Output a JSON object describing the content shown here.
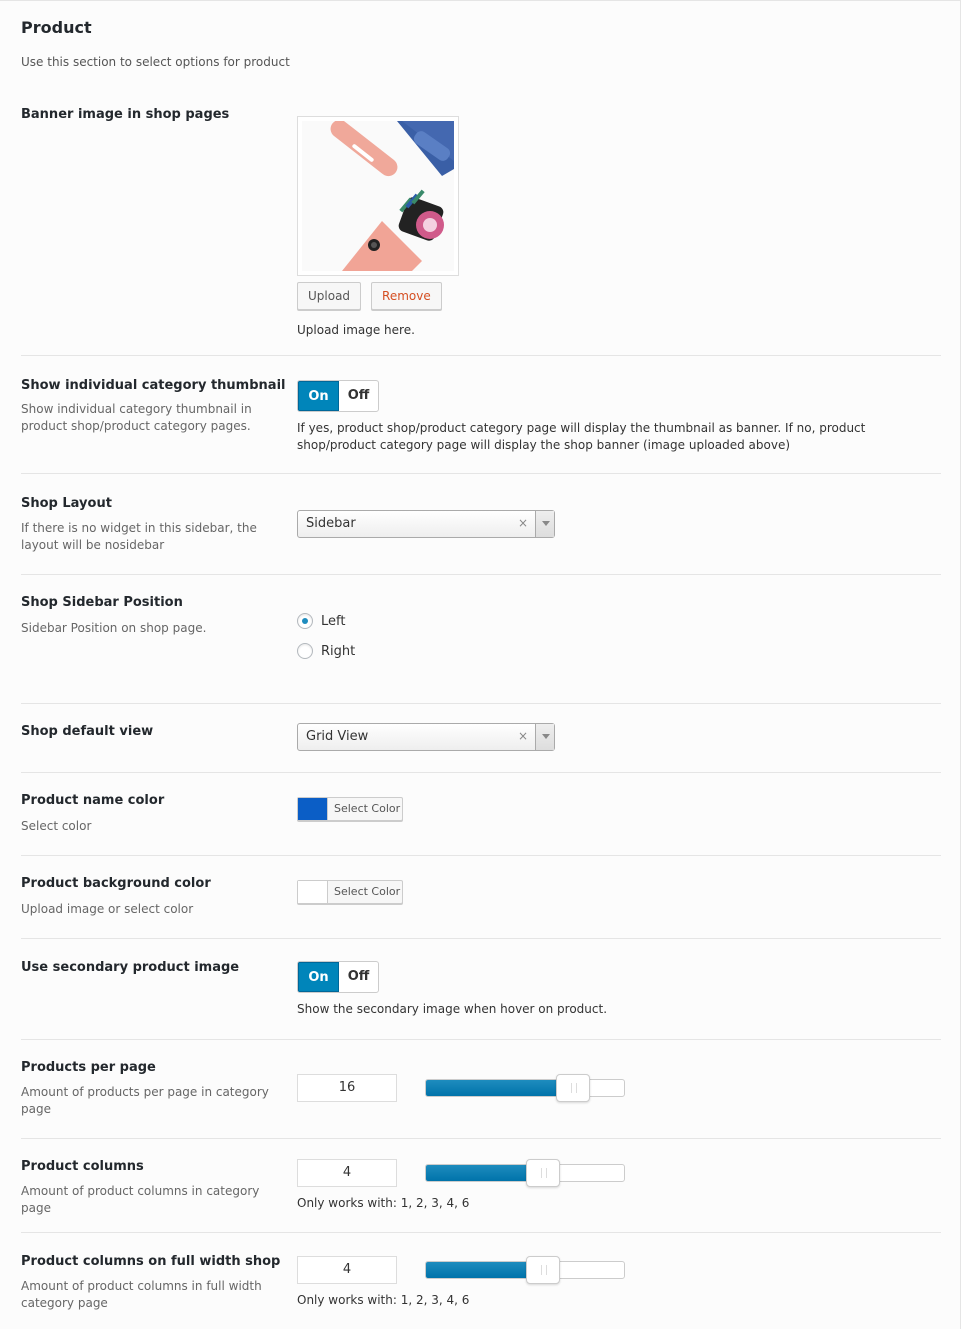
{
  "section": {
    "title": "Product",
    "description": "Use this section to select options for product"
  },
  "banner": {
    "label": "Banner image in shop pages",
    "upload_label": "Upload",
    "remove_label": "Remove",
    "help": "Upload image here."
  },
  "category_thumb": {
    "label": "Show individual category thumbnail",
    "sub": "Show individual category thumbnail in product shop/product category pages.",
    "on_label": "On",
    "off_label": "Off",
    "value": "On",
    "help": "If yes, product shop/product category page will display the thumbnail as banner. If no, product shop/product category page will display the shop banner (image uploaded above)"
  },
  "shop_layout": {
    "label": "Shop Layout",
    "sub": "If there is no widget in this sidebar, the layout will be nosidebar",
    "value": "Sidebar",
    "clear": "×"
  },
  "sidebar_position": {
    "label": "Shop Sidebar Position",
    "sub": "Sidebar Position on shop page.",
    "options": [
      "Left",
      "Right"
    ],
    "selected": "Left"
  },
  "default_view": {
    "label": "Shop default view",
    "value": "Grid View",
    "clear": "×"
  },
  "name_color": {
    "label": "Product name color",
    "sub": "Select color",
    "button_label": "Select Color",
    "color": "#0b5ec6"
  },
  "bg_color": {
    "label": "Product background color",
    "sub": "Upload image or select color",
    "button_label": "Select Color",
    "color": "#ffffff"
  },
  "secondary_image": {
    "label": "Use secondary product image",
    "on_label": "On",
    "off_label": "Off",
    "value": "On",
    "help": "Show the secondary image when hover on product."
  },
  "per_page": {
    "label": "Products per page",
    "sub": "Amount of products per page in category page",
    "value": "16",
    "slider_fraction": 0.74
  },
  "columns": {
    "label": "Product columns",
    "sub": "Amount of product columns in category page",
    "value": "4",
    "slider_fraction": 0.59,
    "help": "Only works with: 1, 2, 3, 4, 6"
  },
  "columns_full": {
    "label": "Product columns on full width shop",
    "sub": "Amount of product columns in full width category page",
    "value": "4",
    "slider_fraction": 0.59,
    "help": "Only works with: 1, 2, 3, 4, 6"
  }
}
